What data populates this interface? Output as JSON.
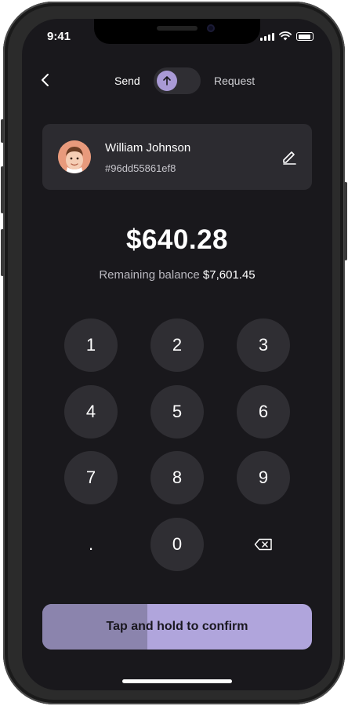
{
  "status_bar": {
    "time": "9:41"
  },
  "header": {
    "send_label": "Send",
    "request_label": "Request",
    "toggle_icon": "arrow-up-icon"
  },
  "recipient": {
    "name": "William Johnson",
    "account": "#96dd55861ef8"
  },
  "amount": "$640.28",
  "balance": {
    "label": "Remaining balance",
    "value": "$7,601.45"
  },
  "keypad": {
    "keys": [
      "1",
      "2",
      "3",
      "4",
      "5",
      "6",
      "7",
      "8",
      "9",
      ".",
      "0"
    ],
    "backspace_icon": "backspace-icon"
  },
  "confirm": {
    "label": "Tap and hold to confirm",
    "progress": 0.39
  },
  "colors": {
    "background": "#19181c",
    "surface": "#2c2b30",
    "accent": "#a99ad6",
    "confirm": "#b0a5dc"
  }
}
